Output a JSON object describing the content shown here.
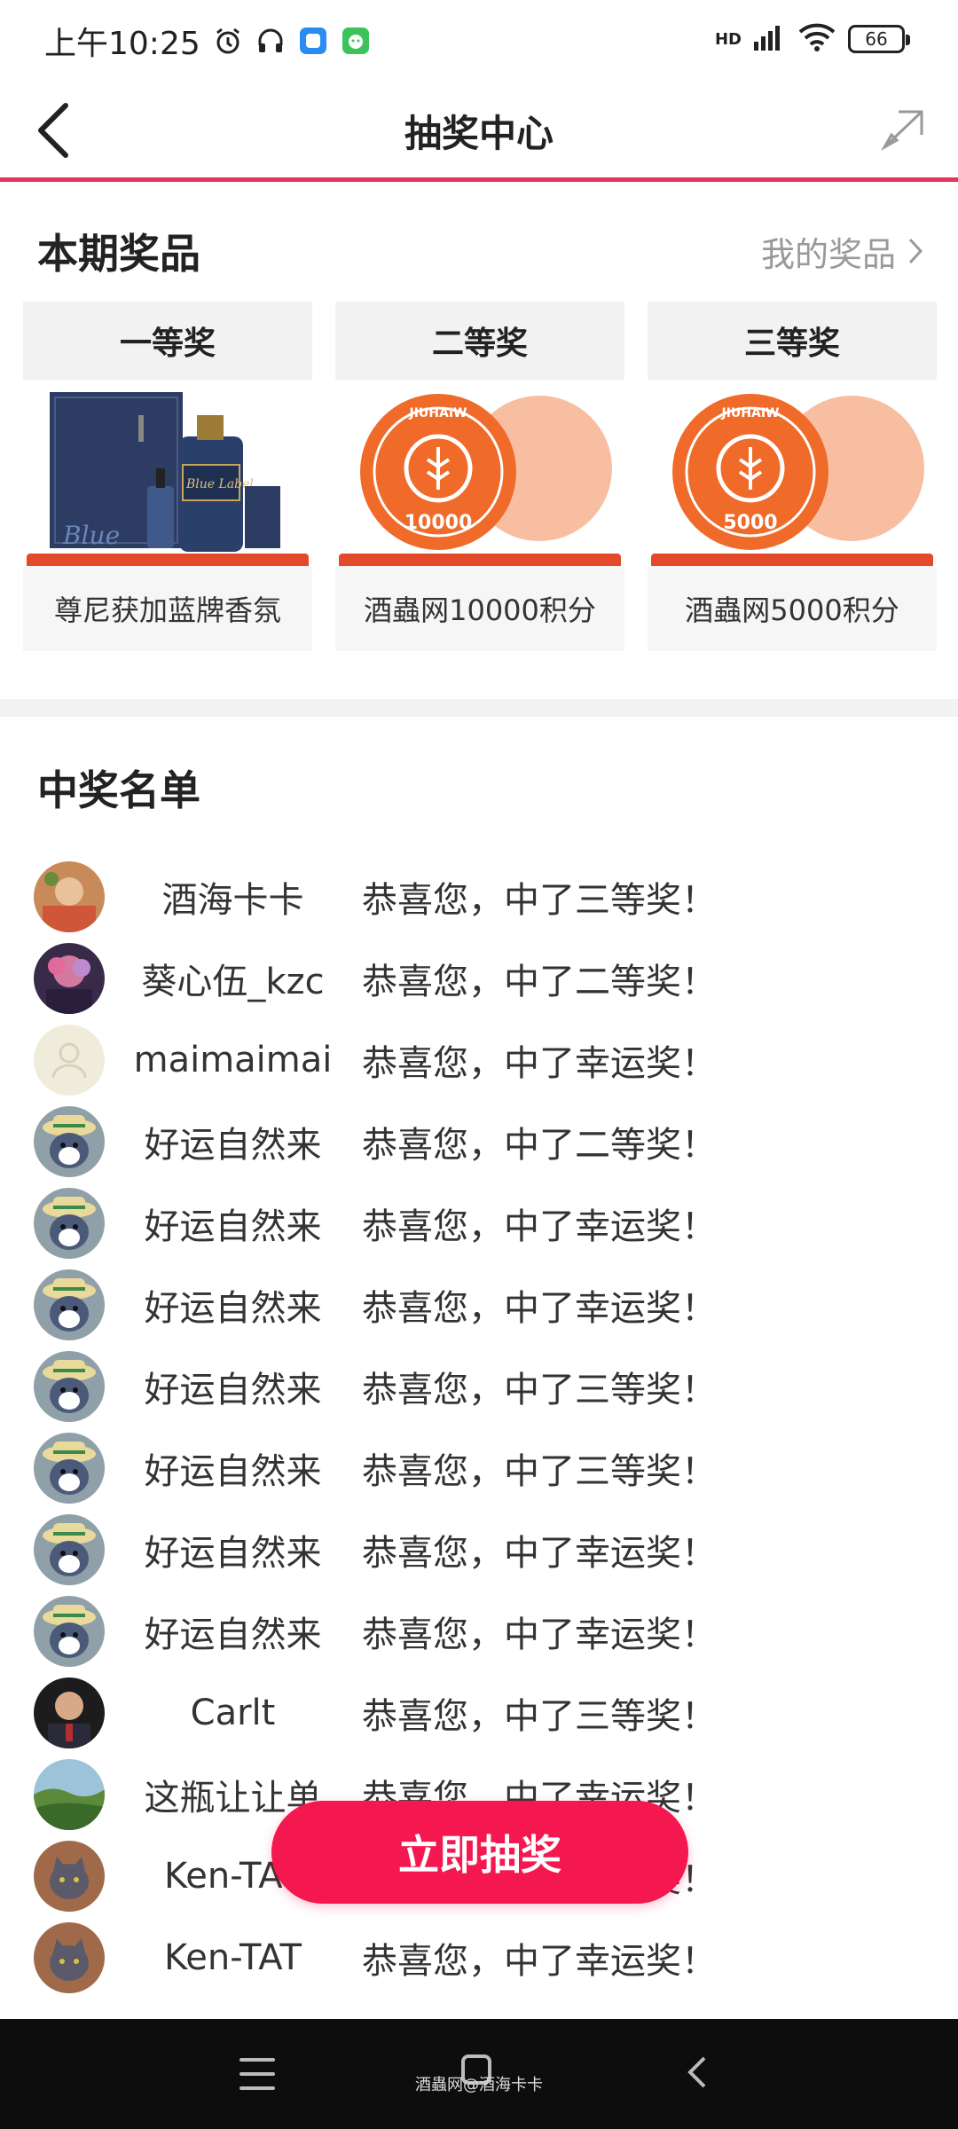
{
  "status_bar": {
    "time": "上午10:25",
    "network": "HD",
    "battery": "66"
  },
  "nav": {
    "title": "抽奖中心"
  },
  "prizes_section": {
    "title": "本期奖品",
    "my_prizes_label": "我的奖品",
    "items": [
      {
        "level": "一等奖",
        "name": "尊尼获加蓝牌香氛",
        "image": "whisky-giftbox"
      },
      {
        "level": "二等奖",
        "name": "酒蟲网10000积分",
        "image": "points-badge-10000"
      },
      {
        "level": "三等奖",
        "name": "酒蟲网5000积分",
        "image": "points-badge-5000"
      }
    ]
  },
  "winners_section": {
    "title": "中奖名单",
    "rows": [
      {
        "name": "酒海卡卡",
        "message": "恭喜您，中了三等奖！",
        "avatar": "photo-avatar-1"
      },
      {
        "name": "葵心伍_kzc",
        "message": "恭喜您，中了二等奖！",
        "avatar": "photo-avatar-2"
      },
      {
        "name": "maimaimai",
        "message": "恭喜您，中了幸运奖！",
        "avatar": "default-avatar"
      },
      {
        "name": "好运自然来",
        "message": "恭喜您，中了二等奖！",
        "avatar": "cartoon-avatar"
      },
      {
        "name": "好运自然来",
        "message": "恭喜您，中了幸运奖！",
        "avatar": "cartoon-avatar"
      },
      {
        "name": "好运自然来",
        "message": "恭喜您，中了幸运奖！",
        "avatar": "cartoon-avatar"
      },
      {
        "name": "好运自然来",
        "message": "恭喜您，中了三等奖！",
        "avatar": "cartoon-avatar"
      },
      {
        "name": "好运自然来",
        "message": "恭喜您，中了三等奖！",
        "avatar": "cartoon-avatar"
      },
      {
        "name": "好运自然来",
        "message": "恭喜您，中了幸运奖！",
        "avatar": "cartoon-avatar"
      },
      {
        "name": "好运自然来",
        "message": "恭喜您，中了幸运奖！",
        "avatar": "cartoon-avatar"
      },
      {
        "name": "Carlt",
        "message": "恭喜您，中了三等奖！",
        "avatar": "photo-avatar-3"
      },
      {
        "name": "这瓶让让单",
        "message": "恭喜您，中了幸运奖！",
        "avatar": "landscape-avatar"
      },
      {
        "name": "Ken-TAT",
        "message": "恭喜您，中了幸运奖！",
        "avatar": "cat-avatar"
      },
      {
        "name": "Ken-TAT",
        "message": "恭喜您，中了幸运奖！",
        "avatar": "cat-avatar"
      }
    ]
  },
  "draw_button": {
    "label": "立即抽奖"
  },
  "watermark": "酒蟲网@酒海卡卡",
  "colors": {
    "accent": "#f5174f",
    "nav_line": "#e2365a",
    "badge_orange": "#f06a2a"
  }
}
